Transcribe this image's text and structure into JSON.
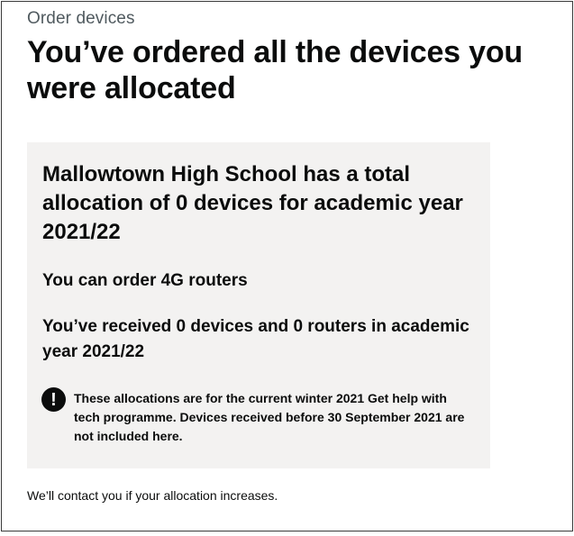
{
  "page": {
    "caption": "Order devices",
    "heading": "You’ve ordered all the devices you were allocated"
  },
  "panel": {
    "title": "Mallowtown High School has a total allocation of 0 devices for academic year 2021/22",
    "routers_text": "You can order 4G routers",
    "received_text": "You’ve received 0 devices and 0 routers in academic year 2021/22",
    "warning": {
      "icon": "exclamation-icon",
      "text": "These allocations are for the current winter 2021 Get help with tech programme. Devices received before 30 September 2021 are not included here."
    }
  },
  "footer": {
    "note": "We’ll contact you if your allocation increases."
  },
  "colors": {
    "text": "#0b0c0c",
    "secondary_text": "#505a5f",
    "panel_background": "#f3f2f1",
    "icon_background": "#0b0c0c"
  }
}
